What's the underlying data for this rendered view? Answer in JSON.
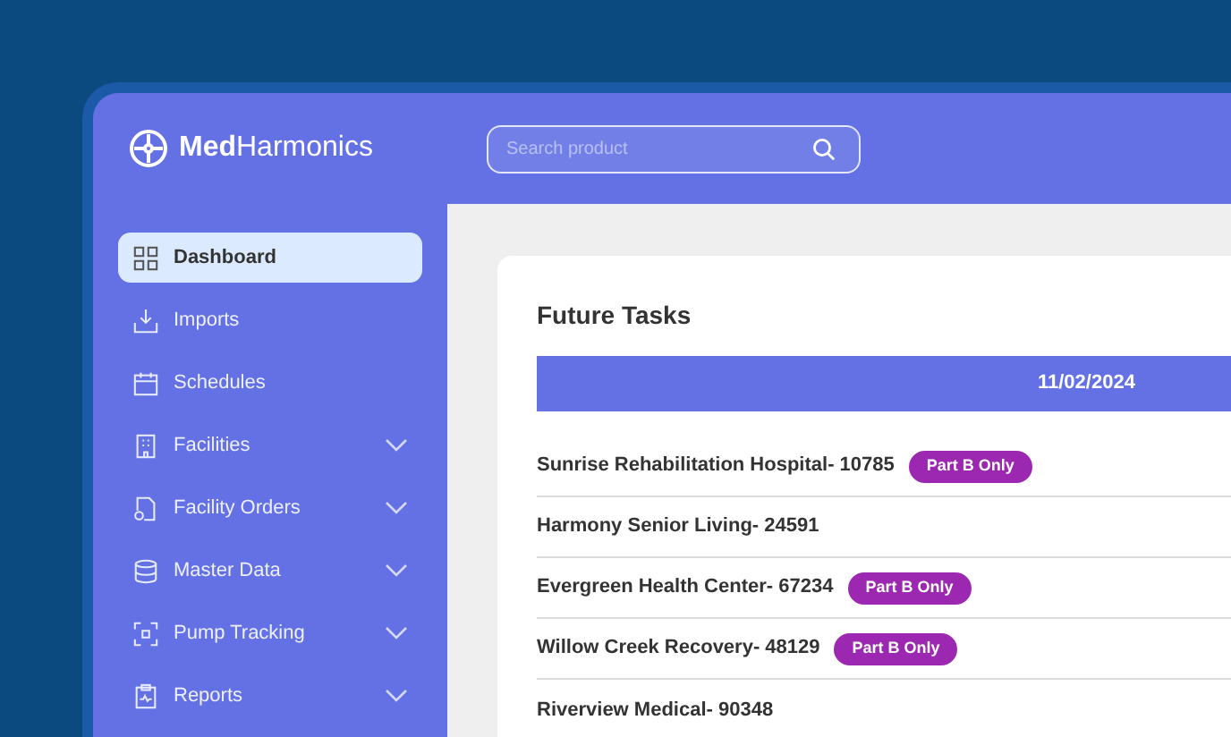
{
  "brand": "**Med**Harmonics",
  "search": {
    "placeholder": "Search product"
  },
  "sidebar": {
    "items": [
      {
        "label": "Dashboard",
        "kind": "link",
        "selected": true
      },
      {
        "label": "Imports",
        "kind": "link",
        "selected": false
      },
      {
        "label": "Schedules",
        "kind": "link",
        "selected": false
      },
      {
        "label": "Facilities",
        "kind": "group",
        "selected": false
      },
      {
        "label": "Facility Orders",
        "kind": "group",
        "selected": false
      },
      {
        "label": "Master Data",
        "kind": "group",
        "selected": false
      },
      {
        "label": "Pump Tracking",
        "kind": "group",
        "selected": false
      },
      {
        "label": "Reports",
        "kind": "group",
        "selected": false
      }
    ]
  },
  "card": {
    "title": "Future Tasks",
    "table": {
      "columns": [
        "11/02/2024"
      ],
      "rows": [
        {
          "name": "Sunrise Rehabilitation Hospital- 10785",
          "badge": "Part B Only"
        },
        {
          "name": "Harmony Senior Living- 24591"
        },
        {
          "name": "Evergreen Health Center- 67234",
          "badge": "Part B Only"
        },
        {
          "name": "Willow Creek Recovery- 48129",
          "badge": "Part B Only"
        },
        {
          "name": "Riverview Medical- 90348"
        }
      ]
    }
  }
}
